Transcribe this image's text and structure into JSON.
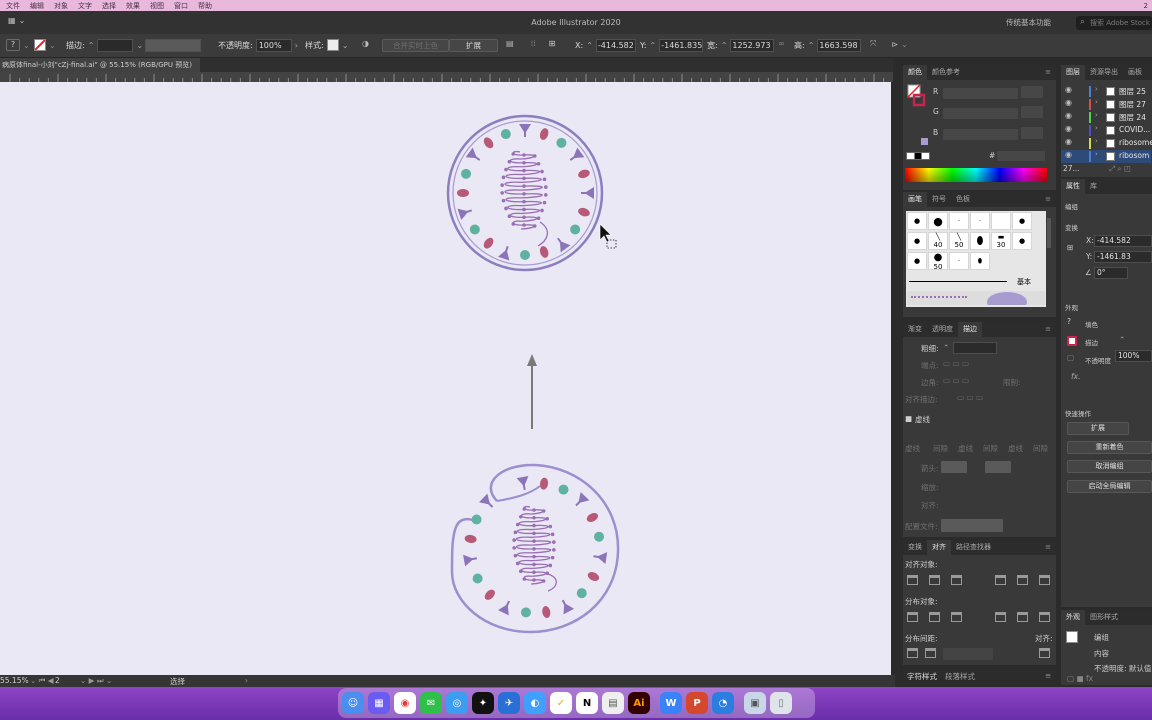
{
  "colors": {
    "menubar_bg": "#e9b9dd",
    "canvas_bg": "#ebe8f5",
    "virus_outline": "#8b7fc0",
    "spike_purple": "#8b74b8",
    "protein_red": "#b65a78",
    "protein_teal": "#5fb1a2",
    "rna_purple": "#9a6fb3",
    "arrow_gray": "#7a7a7a",
    "dock_bg": "#7b3bb8"
  },
  "menubar": {
    "items": [
      "文件",
      "编辑",
      "对象",
      "文字",
      "选择",
      "效果",
      "视图",
      "窗口",
      "帮助"
    ],
    "right": [
      "2"
    ]
  },
  "titlebar": {
    "title": "Adobe Illustrator 2020",
    "workspace": "传统基本功能",
    "search_placeholder": "搜索 Adobe Stock"
  },
  "controlbar": {
    "stroke_label": "描边:",
    "opacity_label": "不透明度:",
    "opacity_value": "100%",
    "style_label": "样式:",
    "merge_button": "合并实时上色",
    "expand_button": "扩展",
    "x_label": "X:",
    "x_value": "-414.582",
    "y_label": "Y:",
    "y_value": "-1461.835",
    "w_label": "宽:",
    "w_value": "1252.973",
    "h_label": "高:",
    "h_value": "1663.598"
  },
  "document": {
    "tab_title": "病原体final-小刘\"cZj-final.ai\" @ 55.15% (RGB/GPU 预览)"
  },
  "statusbar": {
    "zoom": "55.15%",
    "artboard": "2",
    "tool": "选择"
  },
  "panels": {
    "color": {
      "tabs": [
        "颜色",
        "颜色参考"
      ],
      "channels": [
        "R",
        "G",
        "B"
      ],
      "hex_label": "#"
    },
    "brushes": {
      "tabs": [
        "画笔",
        "符号",
        "色板"
      ],
      "sizes": [
        "40",
        "50",
        "30",
        "50"
      ],
      "basic_label": "基本"
    },
    "stroke": {
      "tabs": [
        "渐变",
        "透明度",
        "描边"
      ],
      "weight_label": "粗细:",
      "cap_label": "端点:",
      "corner_label": "边角:",
      "limit_label": "限制:",
      "align_label": "对齐描边:",
      "dashed_label": "虚线",
      "dash_labels": [
        "虚线",
        "间隙",
        "虚线",
        "间隙",
        "虚线",
        "间隙"
      ],
      "arrow_label": "箭头:",
      "scale_label": "缩放:",
      "align2_label": "对齐:",
      "profile_label": "配置文件:"
    },
    "align": {
      "tabs": [
        "变换",
        "对齐",
        "路径查找器"
      ],
      "align_objects": "对齐对象:",
      "distribute_objects": "分布对象:",
      "distribute_spacing": "分布间距:",
      "align_to": "对齐:"
    },
    "bottom_tabs": [
      "字符样式",
      "段落样式"
    ],
    "layers": {
      "tabs": [
        "图层",
        "资源导出",
        "画板"
      ],
      "rows": [
        {
          "name": "图层 25",
          "color": "#4d7fd6"
        },
        {
          "name": "图层 27",
          "color": "#d64d4d"
        },
        {
          "name": "图层 24",
          "color": "#4dd64d"
        },
        {
          "name": "COVID...",
          "color": "#4d4dd6"
        },
        {
          "name": "ribosomes",
          "color": "#d6d64d"
        },
        {
          "name": "ribosom",
          "color": "#4d7fd6"
        }
      ],
      "count": "27..."
    },
    "properties": {
      "tabs": [
        "属性",
        "库"
      ],
      "group_label": "编组",
      "transform_label": "变换",
      "x_label": "X:",
      "x_value": "-414.582",
      "y_label": "Y:",
      "y_value": "-1461.83",
      "angle_value": "0°",
      "appearance_label": "外观",
      "fill_label": "填色",
      "stroke_label": "描边",
      "opacity_label": "不透明度",
      "opacity_value": "100%",
      "fx_label": "fx.",
      "quick_actions_label": "快速操作",
      "expand_button": "扩展",
      "recolor_button": "重新着色",
      "ungroup_button": "取消编组",
      "global_edit_button": "启动全局编辑"
    },
    "appearance": {
      "tabs": [
        "外观",
        "图形样式"
      ],
      "group_label": "编组",
      "content_label": "内容",
      "opacity_row": "不透明度: 默认值"
    }
  }
}
